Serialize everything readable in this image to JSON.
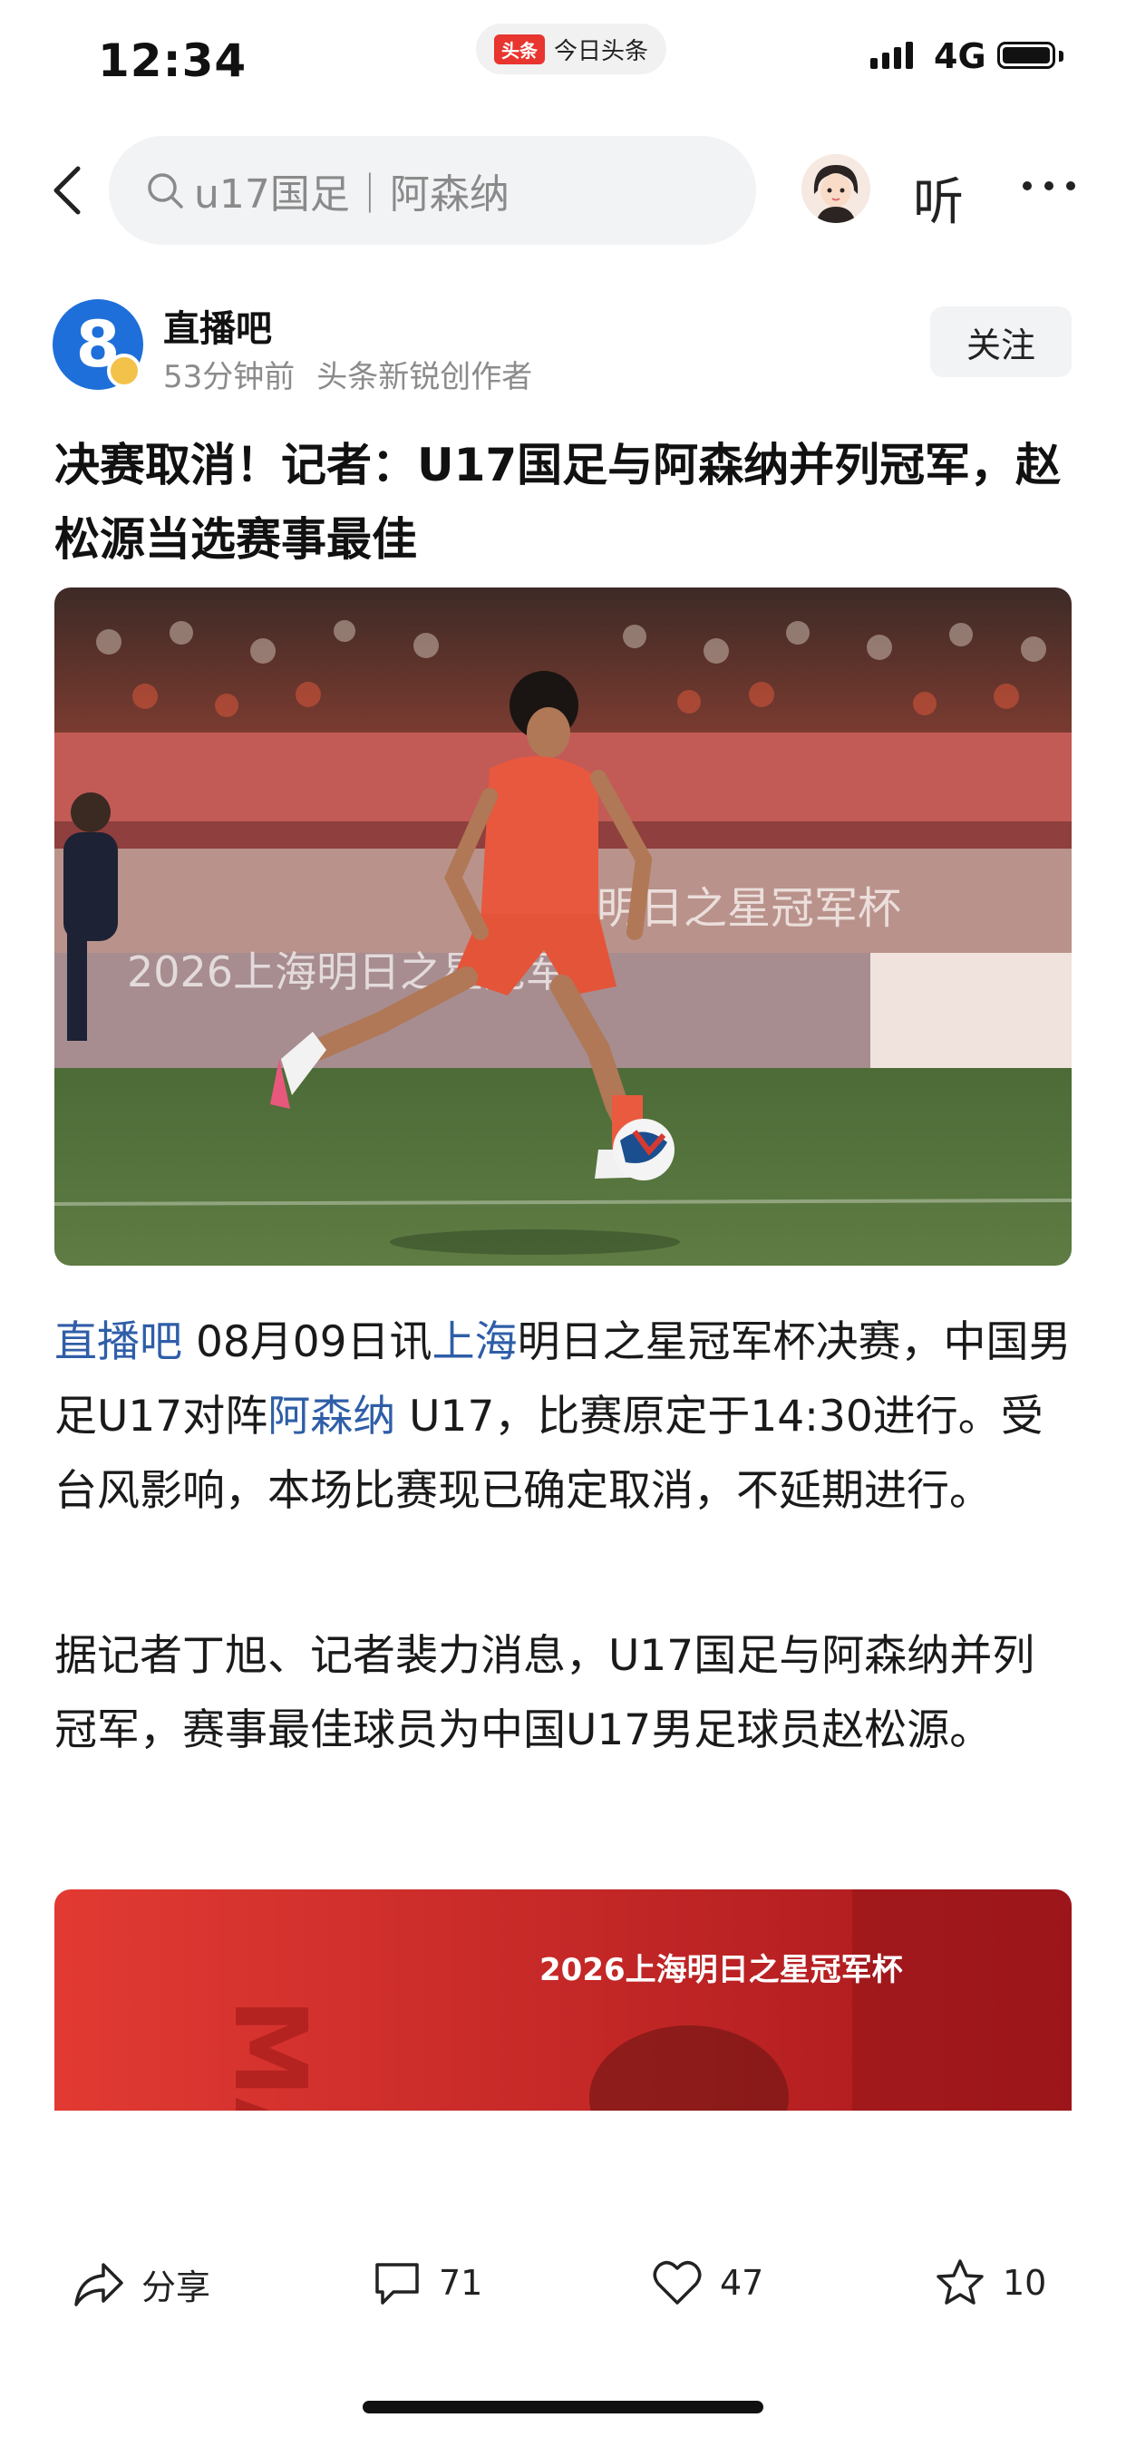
{
  "status_bar": {
    "time": "12:34",
    "app_badge": "头条",
    "app_name": "今日头条",
    "network": "4G"
  },
  "search": {
    "query": "u17国足｜阿森纳"
  },
  "nav": {
    "listen": "听"
  },
  "author": {
    "logo_text": "8",
    "name": "直播吧",
    "time": "53分钟前",
    "tag": "头条新锐创作者",
    "follow": "关注"
  },
  "article": {
    "headline": "决赛取消！记者：U17国足与阿森纳并列冠军，赵松源当选赛事最佳",
    "photo": {
      "board_text_1": "2026上海明日之星冠军杯",
      "board_text_2": "海明日之星冠军杯"
    },
    "p1": {
      "seg1": "直播吧",
      "seg2": " 08月09日讯",
      "seg3": "上海",
      "seg4": "明日之星冠军杯决赛，中国男足U17对阵",
      "seg5": "阿森纳",
      "seg6": " U17，比赛原定于14:30进行。受台风影响，本场比赛现已确定取消，不延期进行。"
    },
    "p2": "据记者丁旭、记者裴力消息，U17国足与阿森纳并列冠军，赛事最佳球员为中国U17男足球员赵松源。",
    "photo2": {
      "title": "2026上海明日之星冠军杯",
      "side_text": "MA"
    }
  },
  "toolbar": {
    "share": "分享",
    "comments": "71",
    "likes": "47",
    "favorites": "10"
  },
  "colors": {
    "link": "#2f5ea8",
    "brand_red": "#e8352f",
    "author_blue": "#1e6fd9"
  }
}
